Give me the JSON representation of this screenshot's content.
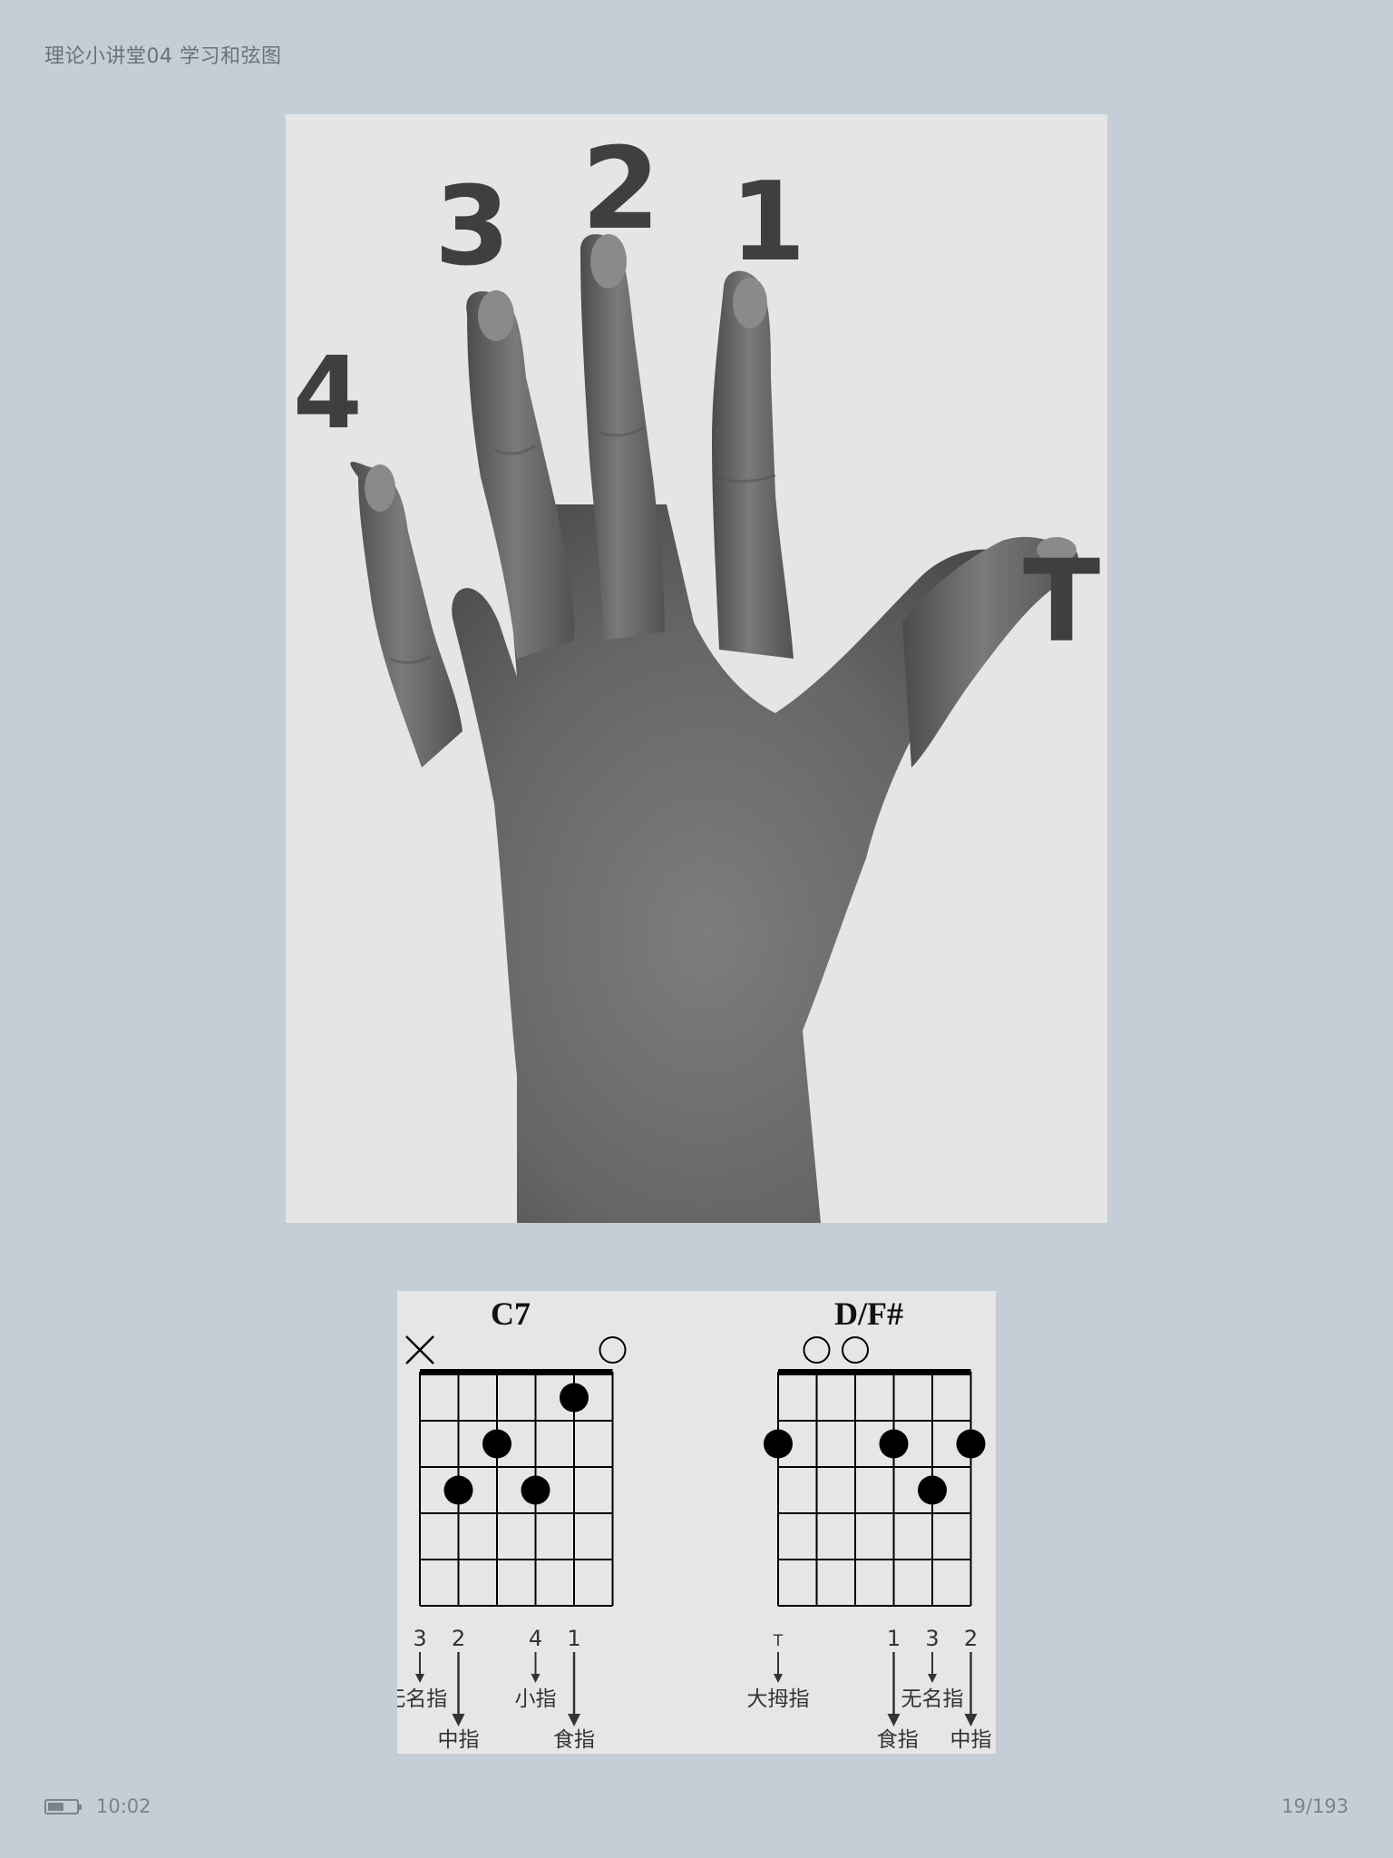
{
  "header": {
    "title": "理论小讲堂04 学习和弦图"
  },
  "hand_photo": {
    "finger_numbers": [
      "4",
      "3",
      "2",
      "1",
      "T"
    ]
  },
  "chord_diagrams": [
    {
      "name": "C7",
      "string_marks": [
        "×",
        "",
        "",
        "",
        "",
        "○"
      ],
      "dots": [
        {
          "string": 5,
          "fret": 1
        },
        {
          "string": 3,
          "fret": 2
        },
        {
          "string": 2,
          "fret": 3
        },
        {
          "string": 4,
          "fret": 3
        }
      ],
      "fingers": [
        "3",
        "2",
        "4",
        "1"
      ],
      "finger_names_upper": [
        "无名指",
        "小指"
      ],
      "finger_names_lower": [
        "中指",
        "食指"
      ]
    },
    {
      "name": "D/F#",
      "string_marks": [
        "",
        "○",
        "○",
        "",
        "",
        ""
      ],
      "dots": [
        {
          "string": 1,
          "fret": 2
        },
        {
          "string": 4,
          "fret": 2
        },
        {
          "string": 6,
          "fret": 2
        },
        {
          "string": 5,
          "fret": 3
        }
      ],
      "fingers": [
        "T",
        "1",
        "3",
        "2"
      ],
      "finger_names_upper": [
        "大拇指",
        "无名指"
      ],
      "finger_names_lower": [
        "食指",
        "中指"
      ]
    }
  ],
  "status_bar": {
    "battery_level": 0.55,
    "time": "10:02",
    "page": "19/193"
  },
  "colors": {
    "background": "#c5ced6",
    "text_muted": "#7a828a"
  }
}
